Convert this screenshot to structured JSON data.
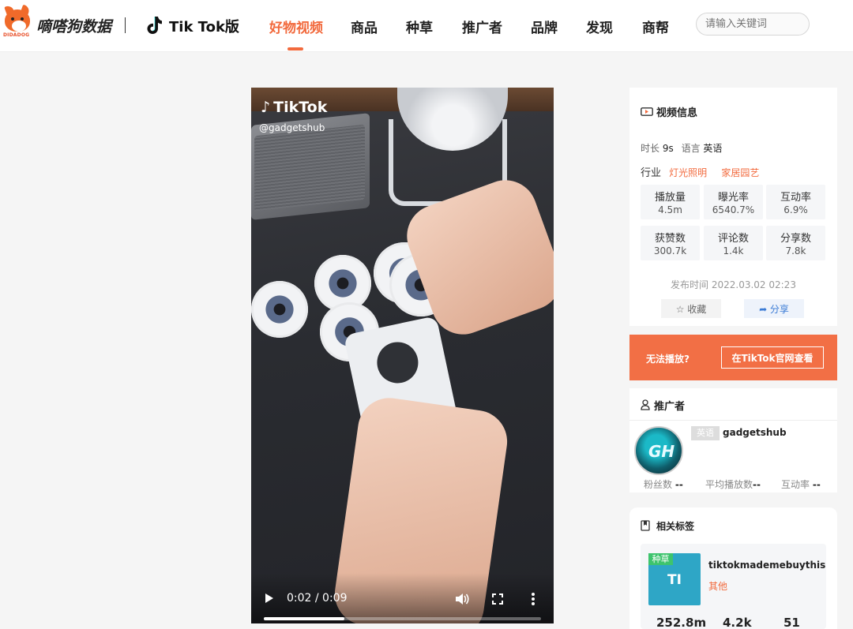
{
  "header": {
    "logo_sub": "DIDADOG",
    "brand": "嘀嗒狗数据",
    "platform": "Tik Tok版",
    "nav": [
      "好物视频",
      "商品",
      "种草",
      "推广者",
      "品牌",
      "发现",
      "商帮"
    ],
    "active_nav": "好物视频",
    "search_placeholder": "请输入关键词"
  },
  "video": {
    "overlay_logo": "TikTok",
    "overlay_user": "@gadgetshub",
    "time": "0:02 / 0:09",
    "progress": 0.29
  },
  "info": {
    "title": "视频信息",
    "duration_label": "时长",
    "duration": "9s",
    "language_label": "语言",
    "language": "英语",
    "industry_label": "行业",
    "industries": [
      "灯光照明",
      "家居园艺"
    ],
    "stats": [
      {
        "label": "播放量",
        "value": "4.5m"
      },
      {
        "label": "曝光率",
        "value": "6540.7%"
      },
      {
        "label": "互动率",
        "value": "6.9%"
      },
      {
        "label": "获赞数",
        "value": "300.7k"
      },
      {
        "label": "评论数",
        "value": "1.4k"
      },
      {
        "label": "分享数",
        "value": "7.8k"
      }
    ],
    "publish_time": "发布时间 2022.03.02 02:23",
    "fav_label": "☆ 收藏",
    "share_label": "➦ 分享"
  },
  "cta": {
    "text": "无法播放?",
    "button": "在TikTok官网查看"
  },
  "promoter": {
    "title": "推广者",
    "avatar_text": "GH",
    "lang_badge": "英语",
    "name": "gadgetshub",
    "fans_label": "粉丝数",
    "fans": "--",
    "avg_play_label": "平均播放数",
    "avg_play": "--",
    "engage_label": "互动率",
    "engage": "--"
  },
  "tags": {
    "title": "相关标签",
    "chip": "种草",
    "thumb_text": "TI",
    "name": "tiktokmademebuythis",
    "category": "其他",
    "numbers": [
      "252.8m",
      "4.2k",
      "51"
    ]
  }
}
